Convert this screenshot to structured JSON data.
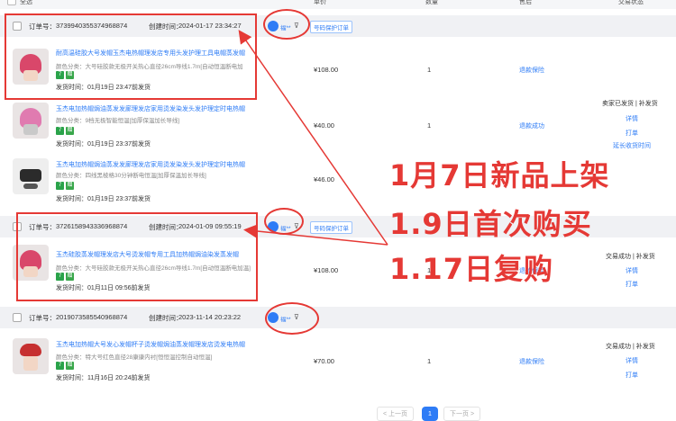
{
  "header": {
    "col_select": "全选",
    "col_price": "单价",
    "col_qty": "数量",
    "col_after": "售后",
    "col_status": "交易状态"
  },
  "colors": {
    "accent": "#2e7cf6",
    "annotation": "#e53935",
    "tag_green": "#2aa34a"
  },
  "orders": [
    {
      "order_no_label": "订单号：",
      "order_no": "3739940355374968874",
      "created_label": "创建时间：",
      "created": "2024-01-17 23:34:27",
      "flag_label": "福**",
      "tag": "号码保护订单",
      "items": [
        {
          "title": "耐高温硅胶大号发帽玉杰电热帽理发店专用头发护理工具电帽蒸发帽",
          "spec": "颜色分类：大号硅胶款无极开关热心直径26cm导线1.7m[自动恒温断电加",
          "badges": [
            "7",
            "赠"
          ],
          "ship": "发货时间：01月19日 23:47前发货",
          "price": "¥108.00",
          "qty": "1",
          "after": "退款保险",
          "status": "",
          "links": []
        },
        {
          "title": "玉杰电加热帽焗油蒸发发廊理发店家用烫发染发头发护理定时电热帽",
          "spec": "颜色分类：9档无极智能恒温[加厚保温加长导线]",
          "badges": [
            "7",
            "赠"
          ],
          "ship": "发货时间：01月19日 23:37前发货",
          "price": "¥40.00",
          "qty": "1",
          "after": "退款成功",
          "status": "卖家已发货 | 补发货",
          "links": [
            "详情",
            "打单",
            "延长收货时间"
          ]
        },
        {
          "title": "玉杰电加热帽焗油蒸发发廊理发店家用烫发染发头发护理定时电热帽",
          "spec": "颜色分类：四线黑棱格30分钟断电恒温[加厚保温加长导线]",
          "badges": [
            "7",
            "赠"
          ],
          "ship": "发货时间：01月19日 23:37前发货",
          "price": "¥46.00",
          "qty": "",
          "after": "",
          "status": "",
          "links": []
        }
      ]
    },
    {
      "order_no_label": "订单号：",
      "order_no": "3726158943336968874",
      "created_label": "创建时间：",
      "created": "2024-01-09 09:55:19",
      "flag_label": "福**",
      "tag": "号码保护订单",
      "items": [
        {
          "title": "玉杰硅胶蒸发帽理发店大号烫发帽专用工具加热帽焗油染发蒸发帽",
          "spec": "颜色分类：大号硅胶款无极开关热心直径26cm导线1.7m[自动恒温断电加温]",
          "badges": [
            "7",
            "赠"
          ],
          "ship": "发货时间：01月11日 09:56前发货",
          "price": "¥108.00",
          "qty": "1",
          "after": "退款保险",
          "status": "交易成功 | 补发货",
          "links": [
            "详情",
            "打单"
          ]
        }
      ]
    },
    {
      "order_no_label": "订单号：",
      "order_no": "2019073585540968874",
      "created_label": "创建时间：",
      "created": "2023-11-14 20:23:22",
      "flag_label": "福**",
      "tag": "",
      "items": [
        {
          "title": "玉杰电加热帽大号发心发帽杯子烫发帽焗油蒸发帽理发店烫发电热帽",
          "spec": "颜色分类：特大号红色直径28康康内衬[恒恒温控制自动恒温]",
          "badges": [
            "7",
            "赠"
          ],
          "ship": "发货时间：11月16日 20:24前发货",
          "price": "¥70.00",
          "qty": "1",
          "after": "退款保险",
          "status": "交易成功 | 补发货",
          "links": [
            "详情",
            "打单"
          ]
        }
      ]
    }
  ],
  "annotations": [
    "1月7日新品上架",
    "1.9日首次购买",
    "1.17日复购"
  ],
  "pagination": {
    "prev": "< 上一页",
    "current": "1",
    "next": "下一页 >"
  }
}
